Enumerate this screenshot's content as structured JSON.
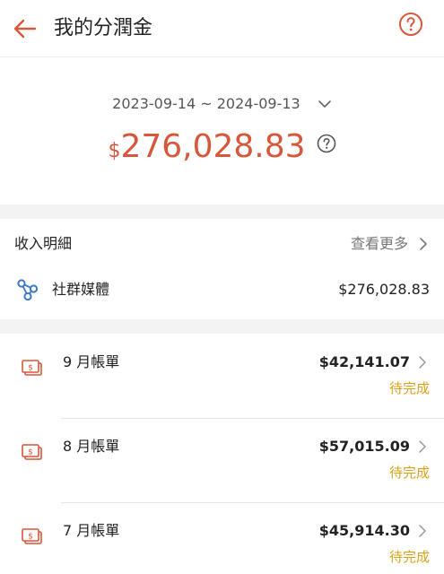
{
  "header": {
    "title": "我的分潤金",
    "back_icon": "back-arrow-icon",
    "help_icon": "help-icon"
  },
  "summary": {
    "date_range": "2023-09-14 ~ 2024-09-13",
    "currency_symbol": "$",
    "total_amount": "276,028.83"
  },
  "income": {
    "label": "收入明細",
    "see_more": "查看更多",
    "source_label": "社群媒體",
    "source_amount": "$276,028.83"
  },
  "bills": [
    {
      "name": "9 月帳單",
      "amount": "$42,141.07",
      "status": "待完成"
    },
    {
      "name": "8 月帳單",
      "amount": "$57,015.09",
      "status": "待完成"
    },
    {
      "name": "7 月帳單",
      "amount": "$45,914.30",
      "status": "待完成"
    }
  ],
  "colors": {
    "accent": "#d6573a",
    "pending": "#d9a21b",
    "divider_bg": "#f3f3f3"
  }
}
